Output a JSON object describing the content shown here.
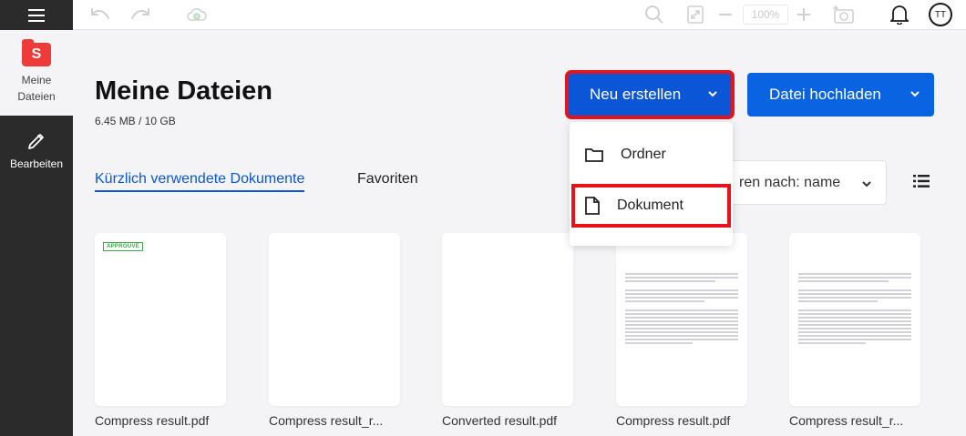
{
  "sidebar": {
    "items": [
      {
        "label": "Meine Dateien",
        "icon": "files-logo-icon"
      },
      {
        "label": "Bearbeiten",
        "icon": "pencil-icon"
      }
    ],
    "logo_letter": "S"
  },
  "toolbar": {
    "zoom": "100%",
    "avatar_initials": "TT"
  },
  "main": {
    "title": "Meine Dateien",
    "storage": "6.45 MB / 10 GB",
    "new_button": "Neu erstellen",
    "upload_button": "Datei hochladen",
    "dropdown": [
      {
        "label": "Ordner",
        "icon": "folder-icon"
      },
      {
        "label": "Dokument",
        "icon": "document-icon"
      }
    ],
    "tabs": [
      {
        "label": "Kürzlich verwendete Dokumente",
        "active": true
      },
      {
        "label": "Favoriten",
        "active": false
      }
    ],
    "sort_label": "ren nach: name",
    "files": [
      {
        "name": "Compress result.pdf",
        "badge": "APPROUVÉ"
      },
      {
        "name": "Compress result_r..."
      },
      {
        "name": "Converted result.pdf"
      },
      {
        "name": "Compress result.pdf"
      },
      {
        "name": "Compress result_r..."
      }
    ]
  },
  "colors": {
    "accent": "#0a63e0",
    "highlight": "#e8121a",
    "sidebar_dark": "#2b2b2b",
    "logo_red": "#ef3a3a"
  }
}
